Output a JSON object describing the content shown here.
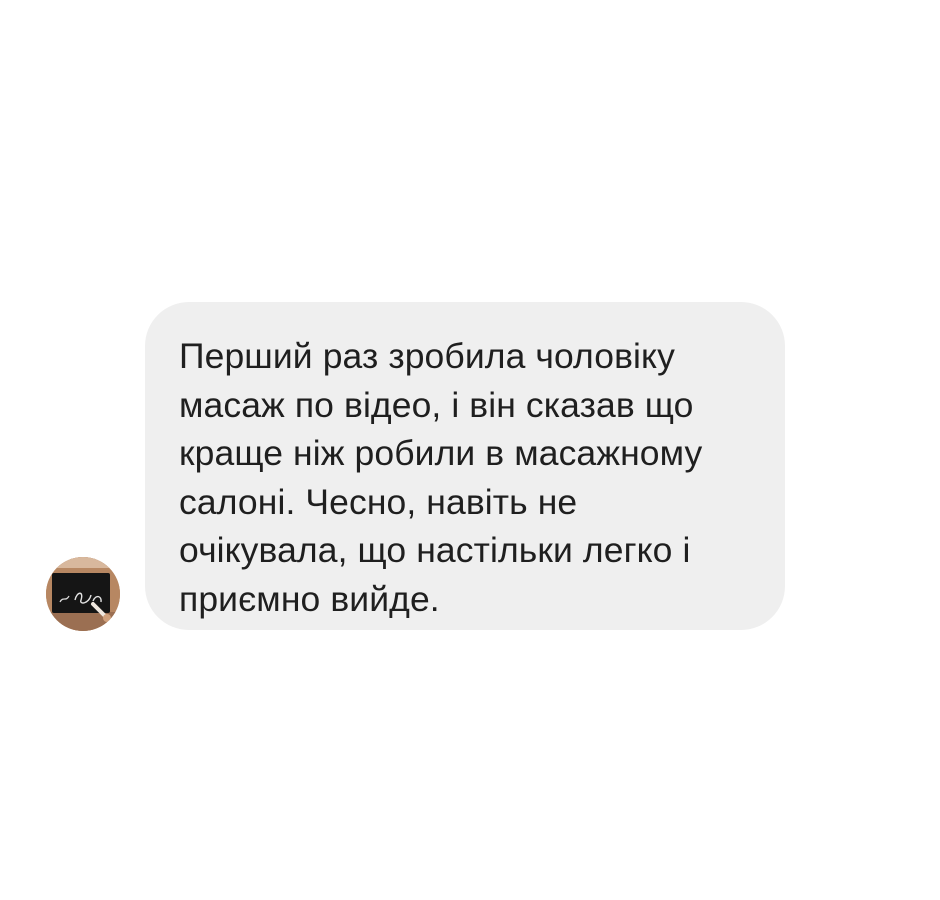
{
  "conversation": {
    "message": {
      "text": "Перший раз зробила чоловіку\nмасаж по відео, і він сказав що\nкраще ніж робили в масажному\nсалоні. Чесно, навіть не\nочікувала, що настільки легко і\nприємно вийде.",
      "bubble_color": "#efefef",
      "text_color": "#1f1f1f"
    },
    "sender": {
      "avatar_icon": "profile-photo-avatar"
    }
  }
}
